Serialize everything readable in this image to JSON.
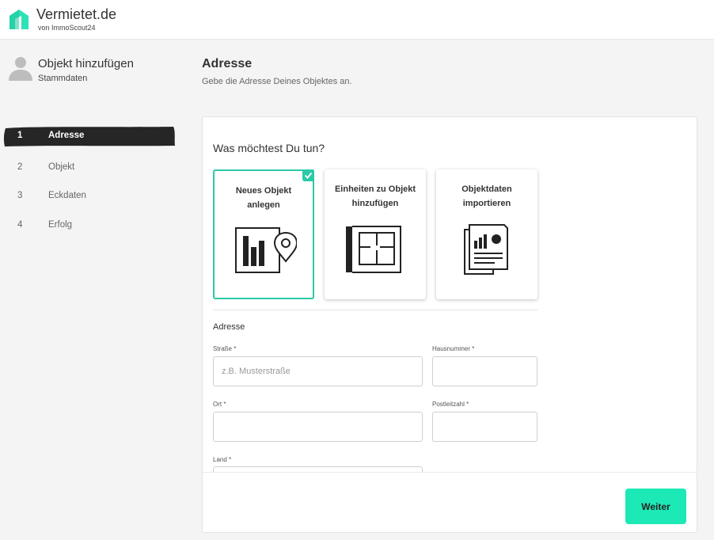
{
  "header": {
    "brand": "Vermietet.de",
    "brand_sub": "von ImmoScout24"
  },
  "sidebar": {
    "title": "Objekt hinzufügen",
    "subtitle": "Stammdaten",
    "steps": [
      {
        "num": "1",
        "label": "Adresse",
        "active": true
      },
      {
        "num": "2",
        "label": "Objekt",
        "active": false
      },
      {
        "num": "3",
        "label": "Eckdaten",
        "active": false
      },
      {
        "num": "4",
        "label": "Erfolg",
        "active": false
      }
    ]
  },
  "main": {
    "title": "Adresse",
    "subtitle": "Gebe die Adresse Deines Objektes an.",
    "question": "Was möchtest Du tun?",
    "options": [
      {
        "label": "Neues Objekt anlegen",
        "icon": "building-location-icon",
        "selected": true
      },
      {
        "label": "Einheiten zu Objekt hinzufügen",
        "icon": "floorplan-icon",
        "selected": false
      },
      {
        "label": "Objektdaten importieren",
        "icon": "documents-chart-icon",
        "selected": false
      }
    ],
    "section_title": "Adresse",
    "fields": {
      "street": {
        "label": "Straße *",
        "placeholder": "z.B. Musterstraße",
        "value": ""
      },
      "house_number": {
        "label": "Hausnummer *",
        "placeholder": "",
        "value": ""
      },
      "city": {
        "label": "Ort *",
        "placeholder": "",
        "value": ""
      },
      "postal_code": {
        "label": "Postleitzahl *",
        "placeholder": "",
        "value": ""
      },
      "country": {
        "label": "Land *",
        "placeholder": "",
        "value": ""
      }
    },
    "next_label": "Weiter"
  },
  "colors": {
    "accent": "#2cc9a7",
    "button": "#1de9b6",
    "active_step": "#262626"
  }
}
